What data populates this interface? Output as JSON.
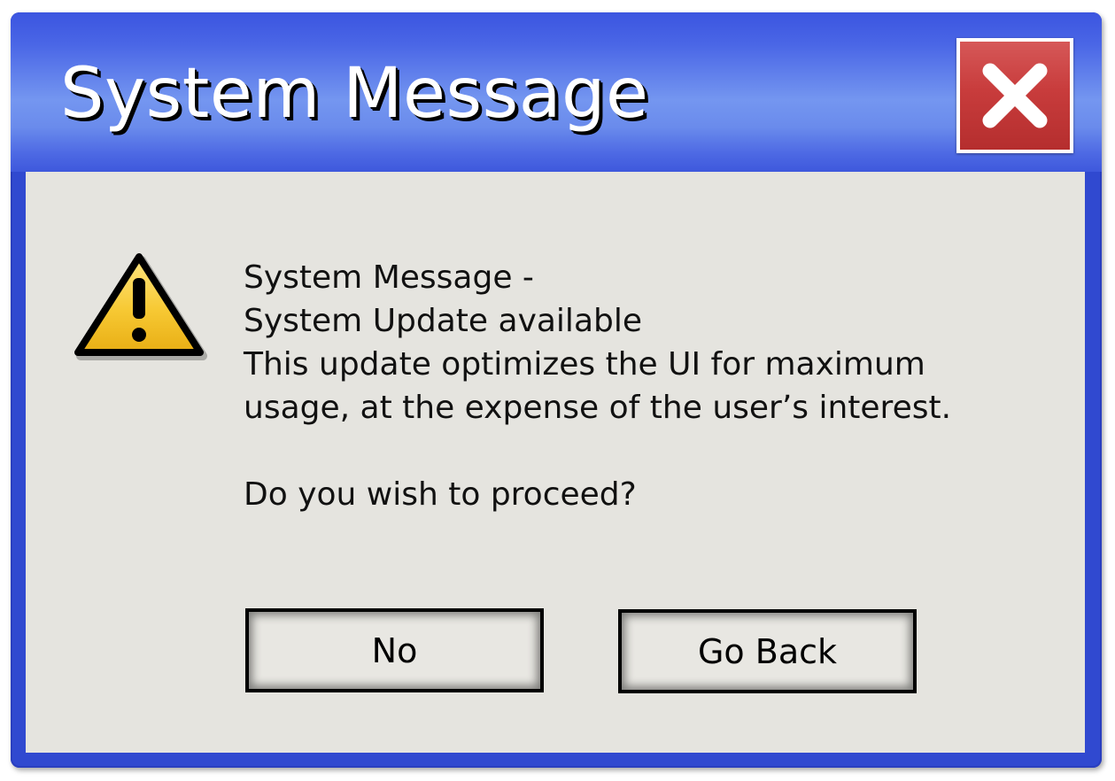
{
  "window": {
    "title": "System Message",
    "close_icon": "close-x-icon",
    "colors": {
      "titlebar_accent": "#4a66e6",
      "frame": "#3049d0",
      "body_background": "#e5e4df",
      "close_button": "#c83c3c"
    }
  },
  "dialog": {
    "icon": "warning-triangle-icon",
    "message_lines": [
      "System Message -",
      "System Update available",
      "This update optimizes the UI for maximum",
      "usage, at the expense of the user’s interest."
    ],
    "question": "Do you wish to proceed?"
  },
  "buttons": {
    "no_label": "No",
    "go_back_label": "Go Back"
  }
}
